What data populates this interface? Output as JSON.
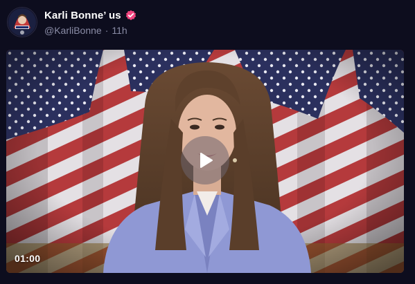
{
  "post": {
    "display_name": "Karli Bonne’ us",
    "handle": "@KarliBonne",
    "separator": "·",
    "time": "11h",
    "verified_icon": "verified-badge-icon",
    "verified_color": "#f0457f"
  },
  "avatar": {
    "icon": "avatar-image"
  },
  "video": {
    "duration": "01:00",
    "play_icon": "play-icon",
    "theme_colors": {
      "flag_red": "#b83a3a",
      "flag_white": "#e6e3e6",
      "flag_blue": "#2a2f5c",
      "blazer": "#8e97d4"
    }
  }
}
